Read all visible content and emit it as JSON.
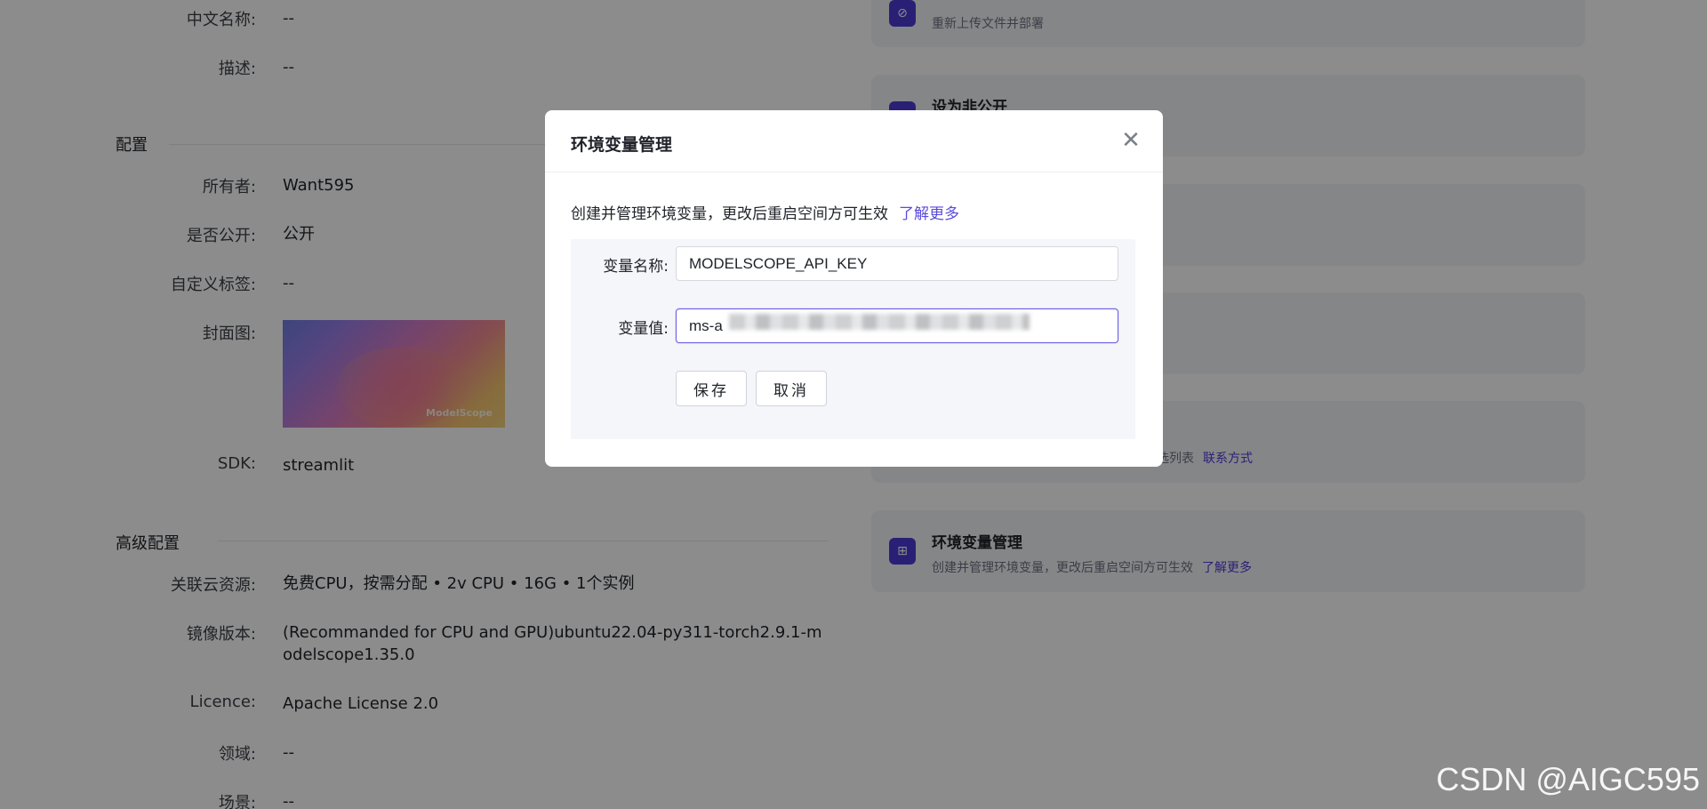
{
  "left_panel": {
    "rows_top": [
      {
        "label": "中文名称:",
        "value": "--"
      },
      {
        "label": "描述:",
        "value": "--"
      }
    ],
    "config_section": {
      "title": "配置",
      "rows": [
        {
          "label": "所有者:",
          "value": "Want595"
        },
        {
          "label": "是否公开:",
          "value": "公开"
        },
        {
          "label": "自定义标签:",
          "value": "--"
        },
        {
          "label": "封面图:",
          "value": ""
        },
        {
          "label": "SDK:",
          "value": "streamlit"
        }
      ],
      "cover_brand": "ModelScope"
    },
    "advanced_section": {
      "title": "高级配置",
      "rows": [
        {
          "label": "关联云资源:",
          "value": "免费CPU，按需分配 • 2v CPU • 16G • 1个实例"
        },
        {
          "label": "镜像版本:",
          "value": "(Recommanded for CPU and GPU)ubuntu22.04-py311-torch2.9.1-modelscope1.35.0"
        },
        {
          "label": "Licence:",
          "value": "Apache License 2.0"
        },
        {
          "label": "领域:",
          "value": "--"
        },
        {
          "label": "场景:",
          "value": "--"
        }
      ]
    }
  },
  "right_cards": [
    {
      "title": "",
      "desc": "重新上传文件并部署",
      "link": ""
    },
    {
      "title": "设为非公开",
      "desc": "",
      "link": ""
    },
    {
      "title": "",
      "desc": "",
      "link": ""
    },
    {
      "title": "",
      "desc": "",
      "link": ""
    },
    {
      "title": "",
      "desc": "页精选列表",
      "link": "联系方式"
    },
    {
      "title": "环境变量管理",
      "desc": "创建并管理环境变量，更改后重启空间方可生效",
      "link": "了解更多"
    }
  ],
  "modal": {
    "title": "环境变量管理",
    "close_glyph": "✕",
    "description": "创建并管理环境变量，更改后重启空间方可生效",
    "learn_more": "了解更多",
    "var_name_label": "变量名称:",
    "var_name_value": "MODELSCOPE_API_KEY",
    "var_value_label": "变量值:",
    "var_value_value": "ms-a",
    "save_label": "保存",
    "cancel_label": "取消"
  },
  "watermark": "CSDN @AIGC595",
  "colors": {
    "accent": "#5b4bdb",
    "overlay": "rgba(0,0,0,0.45)",
    "card_bg": "#f3f4f8"
  }
}
